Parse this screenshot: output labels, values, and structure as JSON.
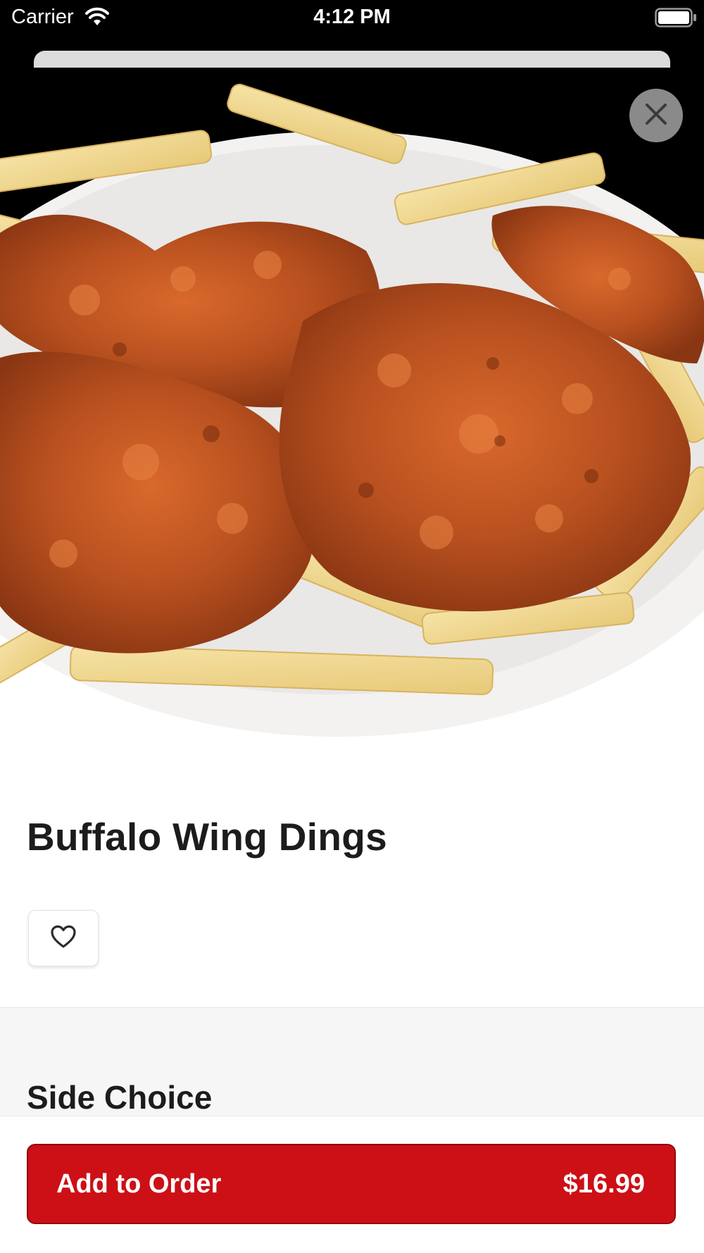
{
  "status_bar": {
    "carrier": "Carrier",
    "time": "4:12 PM",
    "icons": [
      "wifi-icon",
      "battery-icon"
    ]
  },
  "item": {
    "image_description_icon": "food-photo",
    "title": "Buffalo Wing Dings",
    "favorite_icon": "heart-icon",
    "close_icon": "close-icon"
  },
  "options": {
    "section_title": "Side Choice"
  },
  "footer": {
    "add_label": "Add to Order",
    "price": "$16.99"
  },
  "colors": {
    "accent": "#cc1016",
    "text": "#1c1c1e",
    "section_bg": "#f6f6f6"
  }
}
